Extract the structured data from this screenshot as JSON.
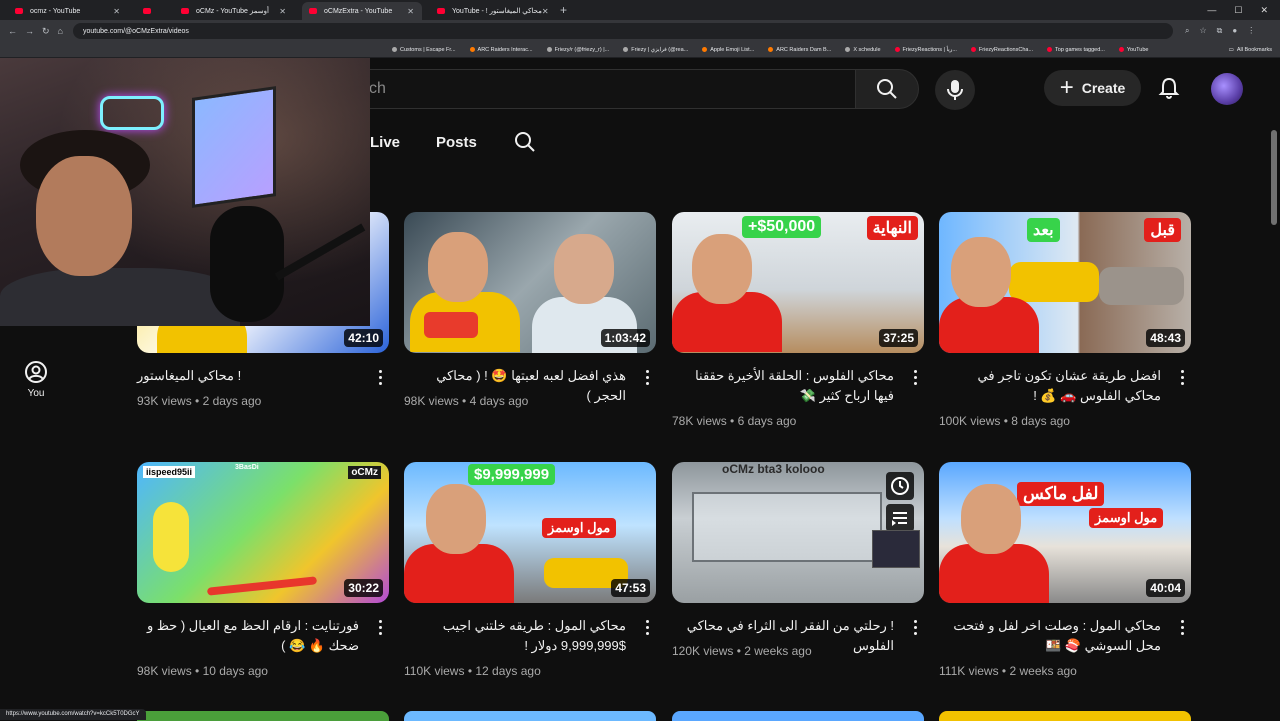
{
  "browser": {
    "tabs": [
      {
        "label": "ocmz - YouTube"
      },
      {
        "label": ""
      },
      {
        "label": "oCMz - YouTube أوسمز"
      },
      {
        "label": "oCMzExtra - YouTube"
      },
      {
        "label": "YouTube - ! محاكي الميغاستور"
      }
    ],
    "url": "youtube.com/@oCMzExtra/videos",
    "bookmarks": [
      "Customs | Escape Fr...",
      "ARC Raiders Interac...",
      "Friezy/r (@friezy_r) |...",
      "Friezy | فرايزي (@rea...",
      "Apple Emoji List...",
      "ARC Raiders Dam B...",
      "X schedule",
      "FriezyReactions | ريأ...",
      "FriezyReactionsCha...",
      "Top games tagged...",
      "YouTube"
    ],
    "all_bookmarks": "All Bookmarks",
    "status_url": "https://www.youtube.com/watch?v=kcCk5T0DGcY"
  },
  "header": {
    "search_placeholder": "ch",
    "create_label": "Create"
  },
  "channel_tabs": {
    "live": "Live",
    "posts": "Posts"
  },
  "sidebar": {
    "you_label": "You"
  },
  "videos": [
    {
      "title": "! محاكي الميغاستور",
      "views": "93K views",
      "age": "2 days ago",
      "duration": "42:10"
    },
    {
      "title": "هذي افضل لعبه لعبتها 🤩 ! ( محاكي الحجر )",
      "views": "98K views",
      "age": "4 days ago",
      "duration": "1:03:42"
    },
    {
      "title": "محاكي الفلوس : الحلقة الأخيرة حققنا فيها ارباح كثير 💸",
      "views": "78K views",
      "age": "6 days ago",
      "duration": "37:25"
    },
    {
      "title": "افضل طريقة عشان تكون تاجر في محاكي الفلوس 🚗 💰 !",
      "views": "100K views",
      "age": "8 days ago",
      "duration": "48:43"
    },
    {
      "title": "فورتنايت : ارقام الحظ مع العيال ( حظ و ضحك 🔥 😂 )",
      "views": "98K views",
      "age": "10 days ago",
      "duration": "30:22"
    },
    {
      "title": "محاكي المول : طريقه خلتني اجيب $9,999,999 دولار !",
      "views": "110K views",
      "age": "12 days ago",
      "duration": "47:53"
    },
    {
      "title": "! رحلتي من الفقر الى الثراء في محاكي الفلوس",
      "views": "120K views",
      "age": "2 weeks ago",
      "duration": ""
    },
    {
      "title": "محاكي المول : وصلت اخر لفل و فتحت محل السوشي 🍣 🍱",
      "views": "111K views",
      "age": "2 weeks ago",
      "duration": "40:04"
    }
  ],
  "thumb_text": {
    "money_50k": "+$50,000",
    "nihaya": "النهاية",
    "baad": "بعد",
    "qabl": "قبل",
    "money_9m": "$9,999,999",
    "mall": "مول اوسمز",
    "lvl_max": "لفل ماكس",
    "player1": "iispeed95ii",
    "player2": "3BasDi",
    "player3": "oCMz",
    "store_sign": "oCMz bta3 kolooo"
  },
  "colors": {
    "bg": "#0f0f0f",
    "red_shirt": "#e3201b",
    "yellow_shirt": "#f2c200",
    "money_green": "#37d34a"
  }
}
